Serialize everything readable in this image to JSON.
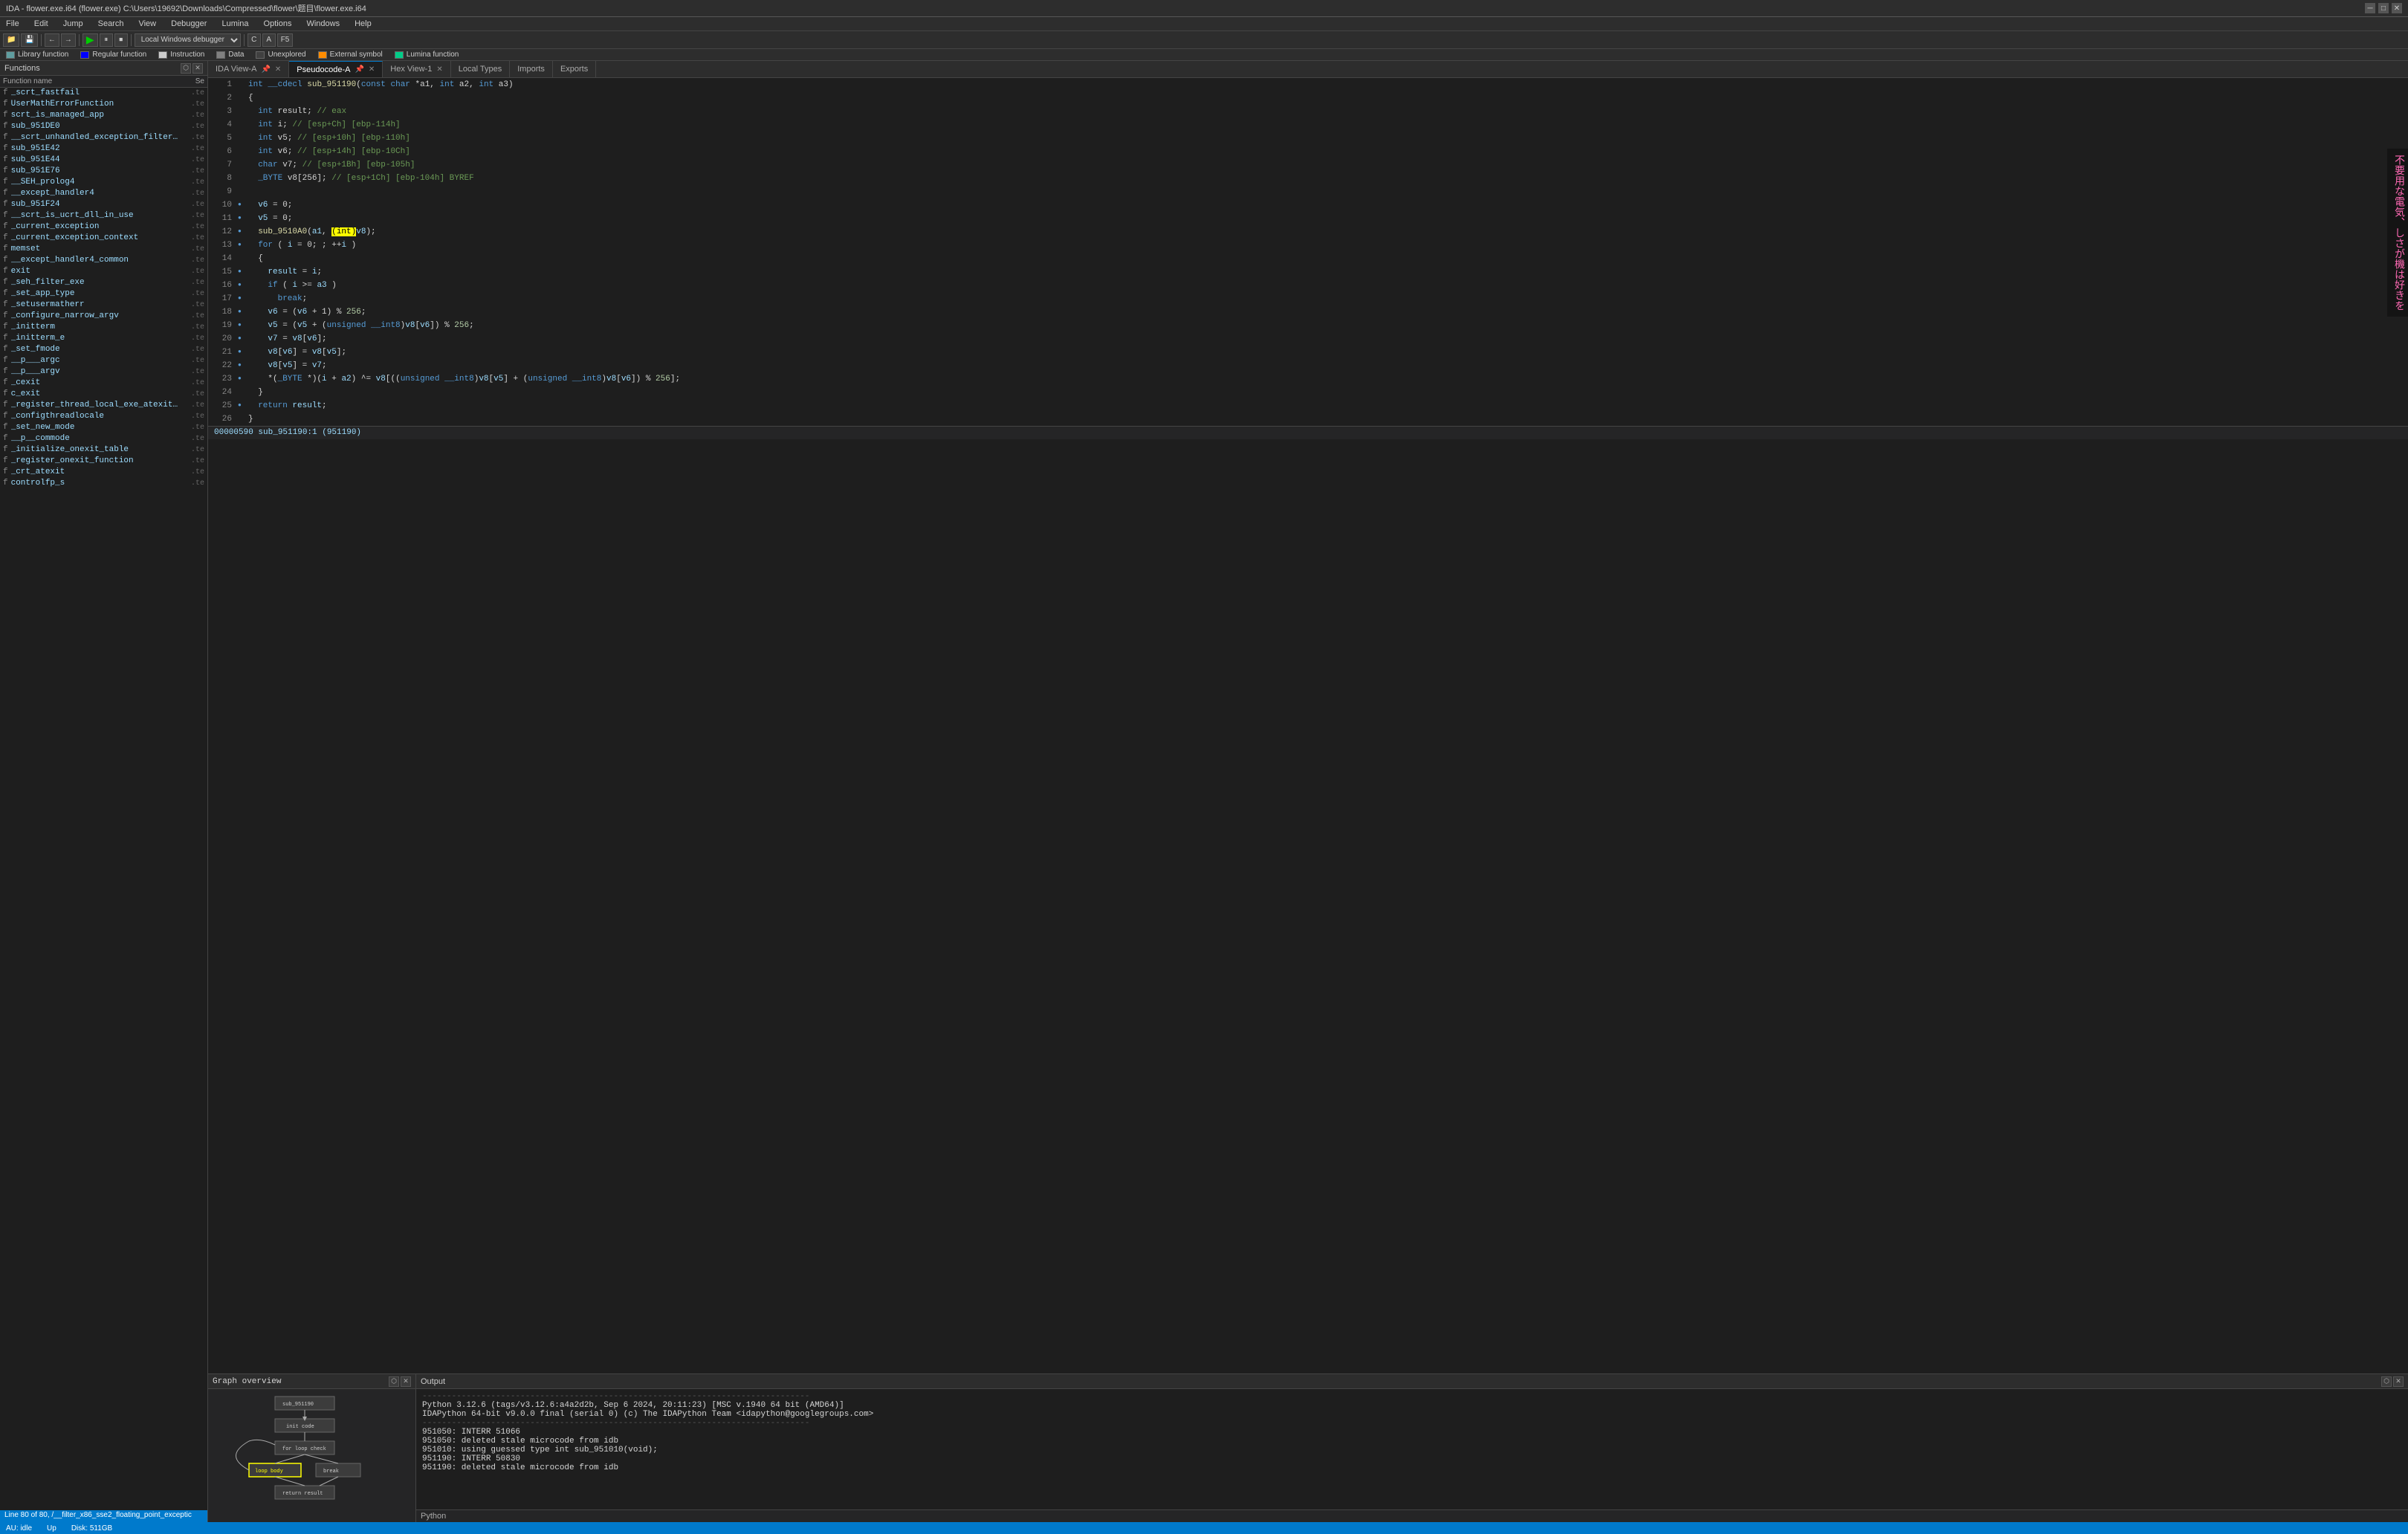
{
  "titlebar": {
    "text": "IDA - flower.exe.i64 (flower.exe) C:\\Users\\19692\\Downloads\\Compressed\\flower\\题目\\flower.exe.i64",
    "win_min": "─",
    "win_restore": "□",
    "win_close": "✕"
  },
  "menubar": {
    "items": [
      "File",
      "Edit",
      "Jump",
      "Search",
      "View",
      "Debugger",
      "Lumina",
      "Options",
      "Windows",
      "Help"
    ]
  },
  "toolbar": {
    "debugger_label": "Local Windows debugger"
  },
  "legend": {
    "items": [
      {
        "color": "#5f9ea0",
        "label": "Library function"
      },
      {
        "color": "#0000ff",
        "label": "Regular function"
      },
      {
        "color": "#cccccc",
        "label": "Instruction"
      },
      {
        "color": "#808080",
        "label": "Data"
      },
      {
        "color": "#404040",
        "label": "Unexplored"
      },
      {
        "color": "#ff8c00",
        "label": "External symbol"
      },
      {
        "color": "#00cc88",
        "label": "Lumina function"
      }
    ]
  },
  "functions_panel": {
    "title": "Functions",
    "col_name": "Function name",
    "col_seg": "Se",
    "items": [
      {
        "name": "_scrt_fastfail",
        "seg": ".te",
        "icon": "f"
      },
      {
        "name": "UserMathErrorFunction",
        "seg": ".te",
        "icon": "f"
      },
      {
        "name": "scrt_is_managed_app",
        "seg": ".te",
        "icon": "f"
      },
      {
        "name": "sub_951DE0",
        "seg": ".te",
        "icon": "f"
      },
      {
        "name": "__scrt_unhandled_exception_filter(x)",
        "seg": ".te",
        "icon": "f"
      },
      {
        "name": "sub_951E42",
        "seg": ".te",
        "icon": "f"
      },
      {
        "name": "sub_951E44",
        "seg": ".te",
        "icon": "f"
      },
      {
        "name": "sub_951E76",
        "seg": ".te",
        "icon": "f"
      },
      {
        "name": "__SEH_prolog4",
        "seg": ".te",
        "icon": "f"
      },
      {
        "name": "__except_handler4",
        "seg": ".te",
        "icon": "f"
      },
      {
        "name": "sub_951F24",
        "seg": ".te",
        "icon": "f"
      },
      {
        "name": "__scrt_is_ucrt_dll_in_use",
        "seg": ".te",
        "icon": "f"
      },
      {
        "name": "_current_exception",
        "seg": ".te",
        "icon": "f"
      },
      {
        "name": "_current_exception_context",
        "seg": ".te",
        "icon": "f"
      },
      {
        "name": "memset",
        "seg": ".te",
        "icon": "f"
      },
      {
        "name": "__except_handler4_common",
        "seg": ".te",
        "icon": "f"
      },
      {
        "name": "exit",
        "seg": ".te",
        "icon": "f"
      },
      {
        "name": "_seh_filter_exe",
        "seg": ".te",
        "icon": "f"
      },
      {
        "name": "_set_app_type",
        "seg": ".te",
        "icon": "f"
      },
      {
        "name": "_setusermatherr",
        "seg": ".te",
        "icon": "f"
      },
      {
        "name": "_configure_narrow_argv",
        "seg": ".te",
        "icon": "f"
      },
      {
        "name": "_initterm",
        "seg": ".te",
        "icon": "f"
      },
      {
        "name": "_initterm_e",
        "seg": ".te",
        "icon": "f"
      },
      {
        "name": "_set_fmode",
        "seg": ".te",
        "icon": "f"
      },
      {
        "name": "__p___argc",
        "seg": ".te",
        "icon": "f"
      },
      {
        "name": "__p___argv",
        "seg": ".te",
        "icon": "f"
      },
      {
        "name": "_cexit",
        "seg": ".te",
        "icon": "f"
      },
      {
        "name": "c_exit",
        "seg": ".te",
        "icon": "f"
      },
      {
        "name": "_register_thread_local_exe_atexit_c...",
        "seg": ".te",
        "icon": "f"
      },
      {
        "name": "_configthreadlocale",
        "seg": ".te",
        "icon": "f"
      },
      {
        "name": "_set_new_mode",
        "seg": ".te",
        "icon": "f"
      },
      {
        "name": "__p__commode",
        "seg": ".te",
        "icon": "f"
      },
      {
        "name": "_initialize_onexit_table",
        "seg": ".te",
        "icon": "f"
      },
      {
        "name": "_register_onexit_function",
        "seg": ".te",
        "icon": "f"
      },
      {
        "name": "_crt_atexit",
        "seg": ".te",
        "icon": "f"
      },
      {
        "name": "controlfp_s",
        "seg": ".te",
        "icon": "f"
      }
    ]
  },
  "statusbar_left": {
    "text": "Line 80 of 80, /__filter_x86_sse2_floating_point_exceptic"
  },
  "tabs": {
    "ida_view_a": {
      "label": "IDA View-A",
      "active": false
    },
    "pseudocode_a": {
      "label": "Pseudocode-A",
      "active": true
    },
    "hex_view_1": {
      "label": "Hex View-1",
      "active": false
    },
    "local_types": {
      "label": "Local Types",
      "active": false
    },
    "imports": {
      "label": "Imports",
      "active": false
    },
    "exports": {
      "label": "Exports",
      "active": false
    }
  },
  "pseudocode": {
    "function_sig": "int __cdecl sub_951190(const char *a1, int a2, int a3)",
    "lines": [
      {
        "num": 1,
        "dot": false,
        "content": "int __cdecl sub_951190(const char *a1, int a2, int a3)",
        "type": "sig"
      },
      {
        "num": 2,
        "dot": false,
        "content": "{",
        "type": "bracket"
      },
      {
        "num": 3,
        "dot": false,
        "content": "  int result; // eax",
        "type": "comment_line"
      },
      {
        "num": 4,
        "dot": false,
        "content": "  int i; // [esp+Ch] [ebp-114h]",
        "type": "comment_line"
      },
      {
        "num": 5,
        "dot": false,
        "content": "  int v5; // [esp+10h] [ebp-110h]",
        "type": "comment_line"
      },
      {
        "num": 6,
        "dot": false,
        "content": "  int v6; // [esp+14h] [ebp-10Ch]",
        "type": "comment_line"
      },
      {
        "num": 7,
        "dot": false,
        "content": "  char v7; // [esp+1Bh] [ebp-105h]",
        "type": "comment_line"
      },
      {
        "num": 8,
        "dot": false,
        "content": "  _BYTE v8[256]; // [esp+1Ch] [ebp-104h] BYREF",
        "type": "comment_line"
      },
      {
        "num": 9,
        "dot": false,
        "content": "",
        "type": "empty"
      },
      {
        "num": 10,
        "dot": true,
        "content": "  v6 = 0;",
        "type": "code"
      },
      {
        "num": 11,
        "dot": true,
        "content": "  v5 = 0;",
        "type": "code"
      },
      {
        "num": 12,
        "dot": true,
        "content": "  sub_9510A0(a1, (int)v8);",
        "type": "code_highlight"
      },
      {
        "num": 13,
        "dot": true,
        "content": "  for ( i = 0; ; ++i )",
        "type": "code"
      },
      {
        "num": 14,
        "dot": false,
        "content": "  {",
        "type": "bracket"
      },
      {
        "num": 15,
        "dot": true,
        "content": "    result = i;",
        "type": "code"
      },
      {
        "num": 16,
        "dot": true,
        "content": "    if ( i >= a3 )",
        "type": "code"
      },
      {
        "num": 17,
        "dot": true,
        "content": "      break;",
        "type": "code"
      },
      {
        "num": 18,
        "dot": true,
        "content": "    v6 = (v6 + 1) % 256;",
        "type": "code"
      },
      {
        "num": 19,
        "dot": true,
        "content": "    v5 = (v5 + (unsigned __int8)v8[v6]) % 256;",
        "type": "code"
      },
      {
        "num": 20,
        "dot": true,
        "content": "    v7 = v8[v6];",
        "type": "code"
      },
      {
        "num": 21,
        "dot": true,
        "content": "    v8[v6] = v8[v5];",
        "type": "code"
      },
      {
        "num": 22,
        "dot": true,
        "content": "    v8[v5] = v7;",
        "type": "code"
      },
      {
        "num": 23,
        "dot": true,
        "content": "    *(_BYTE *)(i + a2) ^= v8[((unsigned __int8)v8[v5] + (unsigned __int8)v8[v6]) % 256];",
        "type": "code"
      },
      {
        "num": 24,
        "dot": false,
        "content": "  }",
        "type": "bracket"
      },
      {
        "num": 25,
        "dot": true,
        "content": "  return result;",
        "type": "code"
      },
      {
        "num": 26,
        "dot": false,
        "content": "}",
        "type": "bracket"
      }
    ]
  },
  "addr_bar": {
    "text": "00000590 sub_951190:1 (951190)"
  },
  "graph_panel": {
    "title": "Graph overview"
  },
  "output_panel": {
    "title": "Output",
    "content": [
      {
        "text": "-------------------------------------------------------------------------------"
      },
      {
        "text": "Python 3.12.6 (tags/v3.12.6:a4a2d2b, Sep  6 2024, 20:11:23) [MSC v.1940 64 bit (AMD64)]"
      },
      {
        "text": "IDAPython 64-bit v9.0.0 final (serial 0) (c) The IDAPython Team <idapython@googlegroups.com>"
      },
      {
        "text": "-------------------------------------------------------------------------------"
      },
      {
        "text": "951050: INTERR 51066"
      },
      {
        "text": "951050: deleted stale microcode from idb"
      },
      {
        "text": "951010: using guessed type int sub_951010(void);"
      },
      {
        "text": "951190: INTERR 50830"
      },
      {
        "text": "951190: deleted stale microcode from idb"
      }
    ],
    "python_label": "Python"
  },
  "bottom_status": {
    "au": "AU: idle",
    "up": "Up",
    "disk": "Disk: 511GB"
  },
  "jp_text": "不要用な電気、しさが機は好きを"
}
